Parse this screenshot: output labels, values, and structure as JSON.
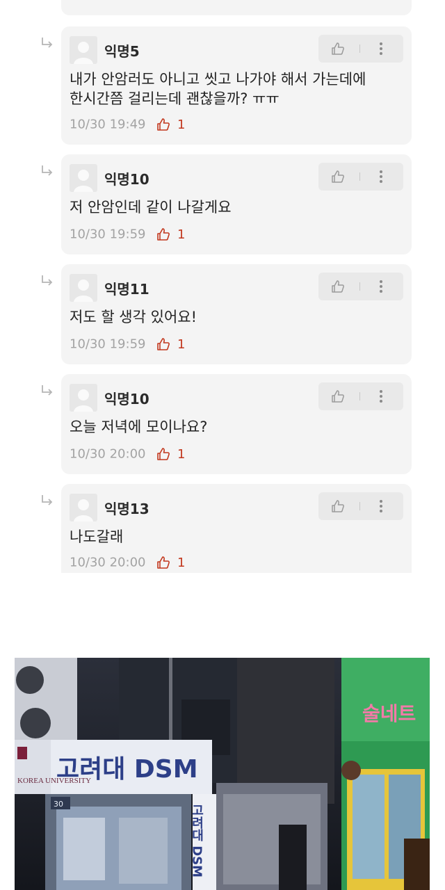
{
  "comments": [
    {
      "author": "익명5",
      "lines": [
        "내가 안암러도 아니고 씻고 나가야 해서 가는데에",
        "한시간쯤 걸리는데 괜찮을까? ㅠㅠ"
      ],
      "time": "10/30 19:49",
      "likes": "1"
    },
    {
      "author": "익명10",
      "lines": [
        "저 안암인데 같이 나갈게요"
      ],
      "time": "10/30 19:59",
      "likes": "1"
    },
    {
      "author": "익명11",
      "lines": [
        "저도 할 생각 있어요!"
      ],
      "time": "10/30 19:59",
      "likes": "1"
    },
    {
      "author": "익명10",
      "lines": [
        "오늘 저녁에 모이나요?"
      ],
      "time": "10/30 20:00",
      "likes": "1"
    },
    {
      "author": "익명13",
      "lines": [
        "나도갈래"
      ],
      "time": "10/30 20:00",
      "likes": "1"
    }
  ],
  "photo": {
    "sign_main": "고려대 DSM",
    "sign_vertical": "고려대 DSM",
    "sign_logo": "KOREA UNIVERSITY",
    "room_number": "30",
    "shop_sign": "술네트"
  },
  "icons": {
    "reply": "reply-arrow-icon",
    "like": "thumbs-up-icon",
    "more": "more-vertical-icon",
    "avatar": "default-avatar-icon"
  },
  "colors": {
    "card_bg": "#f4f4f4",
    "like_count": "#c2371d",
    "meta_text": "#a3a3a3"
  }
}
